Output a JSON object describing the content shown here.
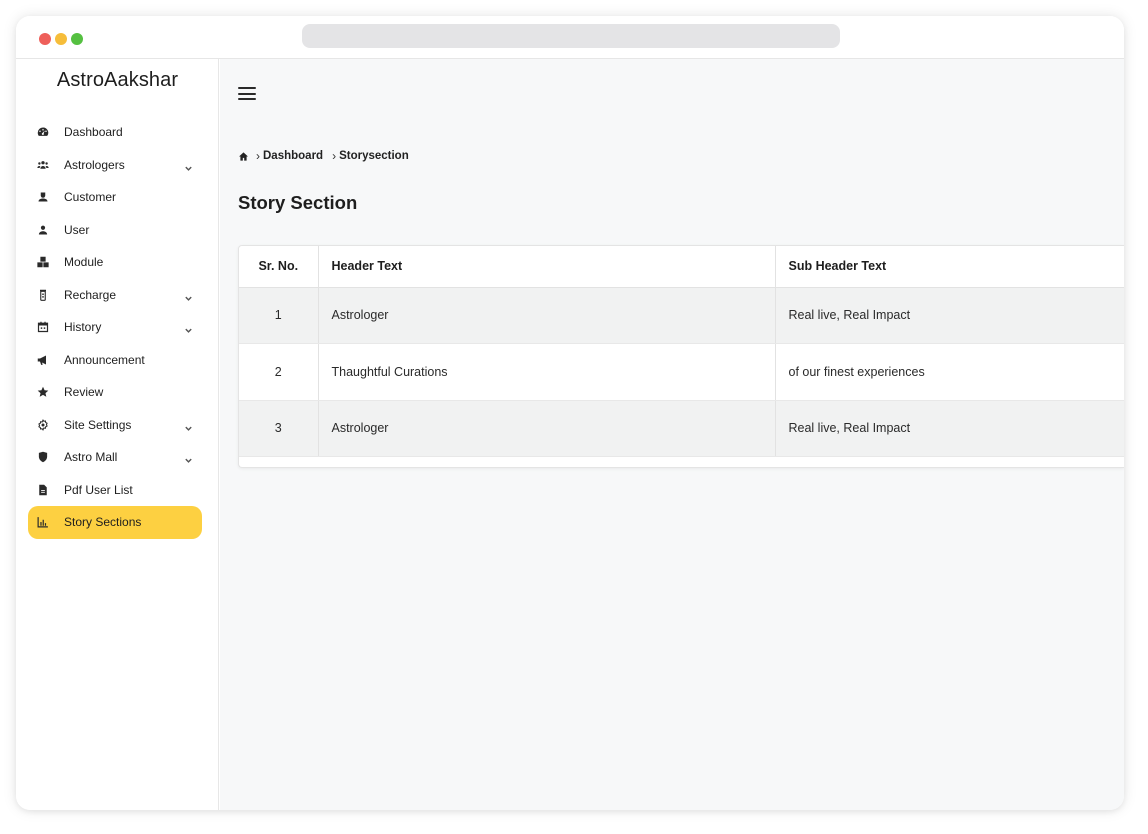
{
  "app": {
    "brand": "AstroAakshar"
  },
  "sidebar": {
    "items": [
      {
        "label": "Dashboard",
        "icon": "dashboard-gauge-icon",
        "expandable": false,
        "active": false
      },
      {
        "label": "Astrologers",
        "icon": "users-group-icon",
        "expandable": true,
        "active": false
      },
      {
        "label": "Customer",
        "icon": "customer-icon",
        "expandable": false,
        "active": false
      },
      {
        "label": "User",
        "icon": "user-icon",
        "expandable": false,
        "active": false
      },
      {
        "label": "Module",
        "icon": "cubes-icon",
        "expandable": false,
        "active": false
      },
      {
        "label": "Recharge",
        "icon": "recharge-icon",
        "expandable": true,
        "active": false
      },
      {
        "label": "History",
        "icon": "history-icon",
        "expandable": true,
        "active": false
      },
      {
        "label": "Announcement",
        "icon": "megaphone-icon",
        "expandable": false,
        "active": false
      },
      {
        "label": "Review",
        "icon": "star-icon",
        "expandable": false,
        "active": false
      },
      {
        "label": "Site Settings",
        "icon": "settings-icon",
        "expandable": true,
        "active": false
      },
      {
        "label": "Astro Mall",
        "icon": "shield-icon",
        "expandable": true,
        "active": false
      },
      {
        "label": "Pdf User List",
        "icon": "document-icon",
        "expandable": false,
        "active": false
      },
      {
        "label": "Story Sections",
        "icon": "bar-chart-icon",
        "expandable": false,
        "active": true
      }
    ],
    "active_color": "#fdd041"
  },
  "breadcrumb": {
    "home_icon": "home-icon",
    "items": [
      "Dashboard",
      "Storysection"
    ]
  },
  "page": {
    "title": "Story Section"
  },
  "table": {
    "columns": [
      "Sr. No.",
      "Header Text",
      "Sub Header Text"
    ],
    "rows": [
      [
        "1",
        "Astrologer",
        "Real live, Real Impact"
      ],
      [
        "2",
        "Thaughtful Curations",
        "of our finest experiences"
      ],
      [
        "3",
        "Astrologer",
        "Real live, Real Impact"
      ]
    ]
  }
}
